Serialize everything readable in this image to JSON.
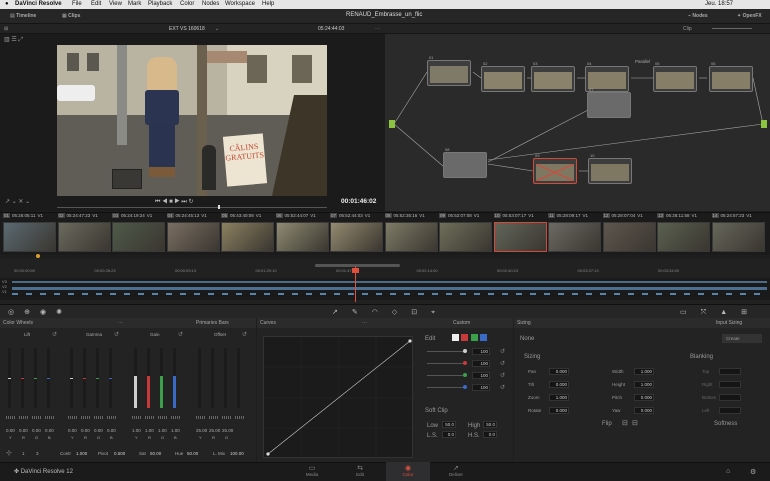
{
  "menubar": {
    "app": "DaVinci Resolve",
    "items": [
      "File",
      "Edit",
      "View",
      "Mark",
      "Playback",
      "Color",
      "Nodes",
      "Workspace",
      "Help"
    ],
    "clock": "Jeu. 18:57"
  },
  "toolbar": {
    "timeline_label": "Timeline",
    "clips_label": "Clips",
    "project_title": "RENAUD_Embrasse_un_flic",
    "nodes_label": "Nodes",
    "openfx_label": "OpenFX"
  },
  "subtool": {
    "timeline_name": "EXT VS 160618",
    "timecode": "05:24:44:03",
    "clip_label": "Clip"
  },
  "viewer": {
    "timecode": "00:01:46:02",
    "sign_line1": "CÂLINS",
    "sign_line2": "GRATUITS"
  },
  "nodes": [
    {
      "num": "01"
    },
    {
      "num": "02"
    },
    {
      "num": "03"
    },
    {
      "num": "04"
    },
    {
      "num": "05"
    },
    {
      "num": "06"
    },
    {
      "num": "07"
    },
    {
      "num": "08"
    },
    {
      "num": "09"
    },
    {
      "num": "10"
    },
    {
      "num": "11"
    }
  ],
  "node_parallel_label": "Parallel",
  "clips": [
    {
      "num": "01",
      "tc": "05:26:05:11",
      "track": "V1",
      "color": "#5a6a72"
    },
    {
      "num": "02",
      "tc": "05:24:47:23",
      "track": "V1",
      "color": "#6b6a5e"
    },
    {
      "num": "03",
      "tc": "05:24:19:24",
      "track": "V1",
      "color": "#4f5a4a"
    },
    {
      "num": "04",
      "tc": "05:24:45:13",
      "track": "V1",
      "color": "#7a6e62"
    },
    {
      "num": "05",
      "tc": "05:43:40:08",
      "track": "V1",
      "color": "#8a8060"
    },
    {
      "num": "06",
      "tc": "05:52:44:07",
      "track": "V1",
      "color": "#8e8a72"
    },
    {
      "num": "07",
      "tc": "05:52:44:03",
      "track": "V1",
      "color": "#948a70"
    },
    {
      "num": "08",
      "tc": "05:52:35:16",
      "track": "V1",
      "color": "#7d7b66"
    },
    {
      "num": "09",
      "tc": "05:52:07:08",
      "track": "V1",
      "color": "#6e6e5a"
    },
    {
      "num": "10",
      "tc": "05:53:07:17",
      "track": "V1",
      "color": "#62655a"
    },
    {
      "num": "11",
      "tc": "05:28:09:17",
      "track": "V1",
      "color": "#6b6a62"
    },
    {
      "num": "12",
      "tc": "05:28:07:04",
      "track": "V1",
      "color": "#5e564e"
    },
    {
      "num": "13",
      "tc": "05:28:11:58",
      "track": "V1",
      "color": "#5a6050"
    },
    {
      "num": "14",
      "tc": "05:24:57:23",
      "track": "V1",
      "color": "#66665a"
    }
  ],
  "timeline_ruler": [
    "00:00:00:00",
    "00:00:26:23",
    "00:00:53:13",
    "00:01:20:10",
    "00:01:47:09",
    "00:02:14:00",
    "00:02:40:23",
    "00:03:07:13",
    "00:03:34:09"
  ],
  "color_wheels": {
    "title": "Color Wheels",
    "mode": "Primaries Bars",
    "wheels": [
      {
        "name": "Lift",
        "values": [
          "0.00",
          "0.00",
          "0.00",
          "0.00"
        ]
      },
      {
        "name": "Gamma",
        "values": [
          "0.00",
          "0.00",
          "0.00",
          "0.00"
        ]
      },
      {
        "name": "Gain",
        "values": [
          "1.00",
          "1.00",
          "1.00",
          "1.00"
        ]
      },
      {
        "name": "Offset",
        "values": [
          "25.00",
          "25.00",
          "25.00"
        ]
      }
    ],
    "channel_letters": [
      "Y",
      "R",
      "G",
      "B"
    ],
    "bottom": {
      "contrast_label": "Contr",
      "contrast": "1.000",
      "pivot_label": "Pivot",
      "pivot": "0.500",
      "sat_label": "Sat",
      "sat": "50.00",
      "hue_label": "Hue",
      "hue": "50.00",
      "lum_label": "L. Mix",
      "lum": "100.00",
      "page1": "1",
      "page2": "3"
    }
  },
  "curves": {
    "title": "Curves",
    "mode": "Custom",
    "edit_label": "Edit",
    "intensities": [
      "100",
      "100",
      "100",
      "100"
    ],
    "soft_clip_label": "Soft Clip",
    "low_label": "Low",
    "low": "50.0",
    "high_label": "High",
    "high": "50.0",
    "ls_label": "L.S.",
    "ls": "0.0",
    "hs_label": "H.S.",
    "hs": "0.0"
  },
  "sizing": {
    "title": "Sizing",
    "mode": "Input Sizing",
    "preset_label": "None",
    "create_label": "Create",
    "sizing_section": "Sizing",
    "pan_label": "Pan",
    "pan": "0.000",
    "tilt_label": "Tilt",
    "tilt": "0.000",
    "zoom_label": "Zoom",
    "zoom": "1.000",
    "rotate_label": "Rotate",
    "rotate": "0.000",
    "width_label": "Width",
    "width": "1.000",
    "height_label": "Height",
    "height": "1.000",
    "pitch_label": "Pitch",
    "pitch": "0.000",
    "yaw_label": "Yaw",
    "yaw": "0.000",
    "flip_label": "Flip",
    "blanking_section": "Blanking",
    "top_label": "Top",
    "right_label": "Right",
    "bottom_label": "Bottom",
    "left_label": "Left",
    "softness_label": "Softness"
  },
  "bottombar": {
    "app_version": "DaVinci Resolve 12",
    "pages": [
      {
        "name": "Media",
        "icon": "▭",
        "active": false
      },
      {
        "name": "Edit",
        "icon": "⇆",
        "active": false
      },
      {
        "name": "Color",
        "icon": "◉",
        "active": true
      },
      {
        "name": "Deliver",
        "icon": "➚",
        "active": false
      }
    ]
  },
  "colors": {
    "accent": "#d24a3a",
    "playhead": "#e0503e",
    "node_line": "#8cc63f"
  }
}
